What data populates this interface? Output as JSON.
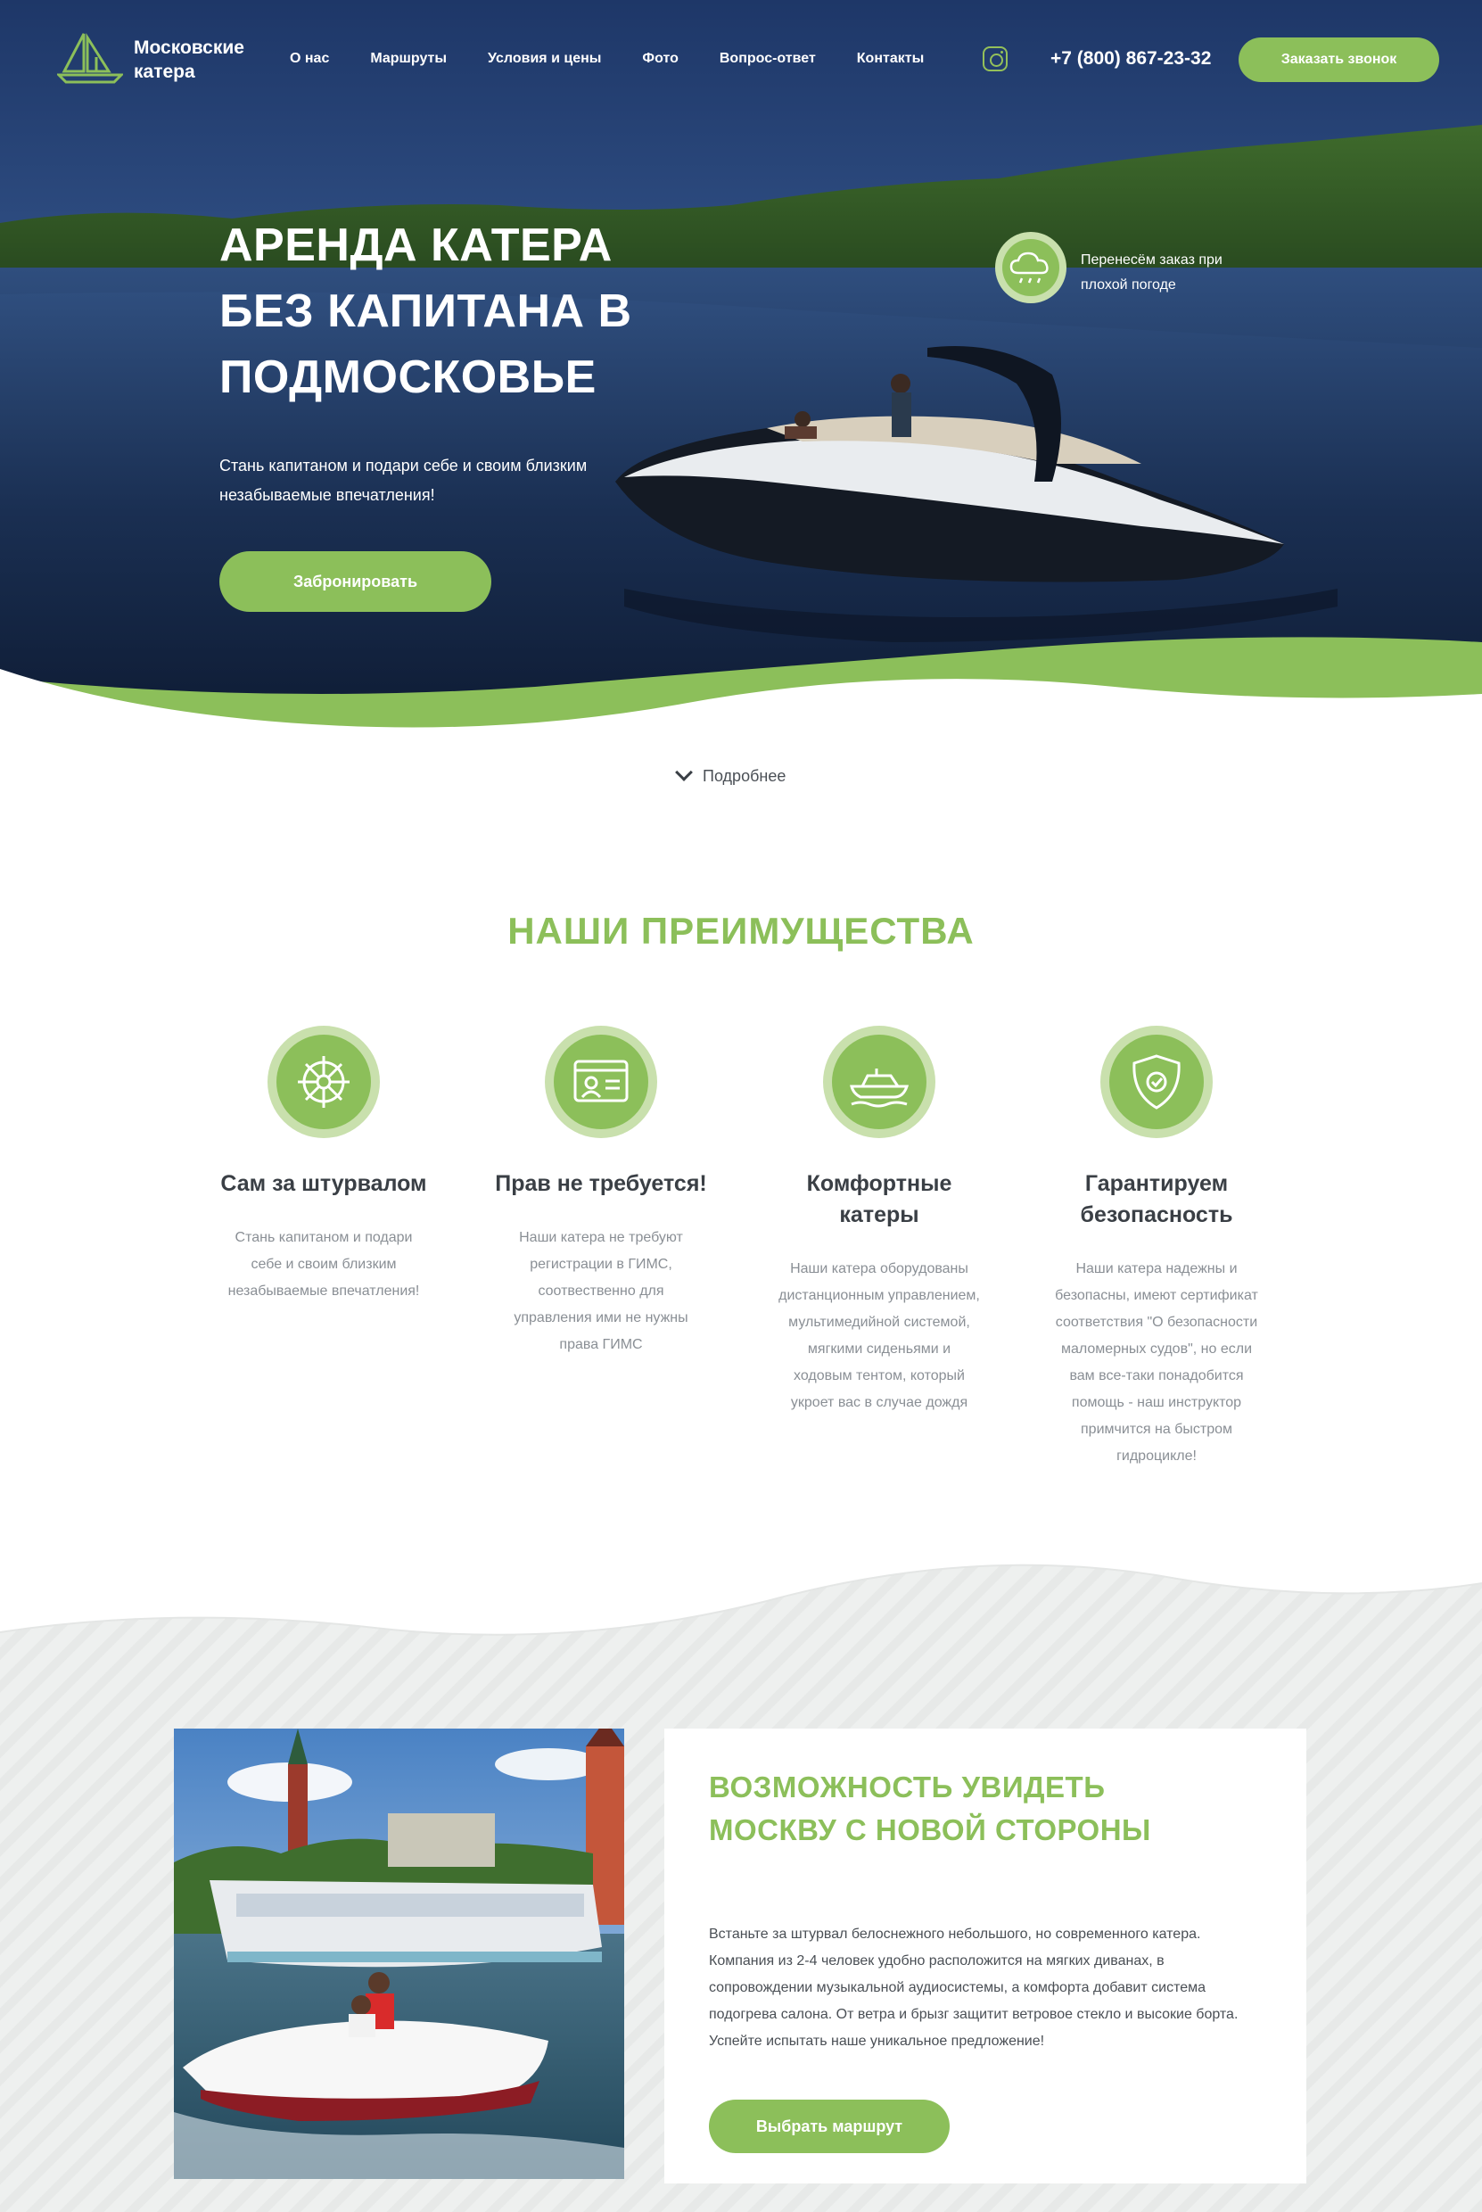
{
  "header": {
    "logo_text": "Московские катера",
    "nav": [
      "О нас",
      "Маршруты",
      "Условия и цены",
      "Фото",
      "Вопрос-ответ",
      "Контакты"
    ],
    "phone": "+7 (800) 867-23-32",
    "call_button": "Заказать звонок"
  },
  "hero": {
    "title": "Аренда катера без капитана в Подмосковье",
    "subtitle": "Стань капитаном и подари себе и своим близким незабываемые впечатления!",
    "book_button": "Забронировать",
    "weather_note": "Перенесём заказ при плохой погоде"
  },
  "more_link": "Подробнее",
  "advantages": {
    "title": "НАШИ ПРЕИМУЩЕСТВА",
    "items": [
      {
        "icon": "helm-icon",
        "title": "Сам за штурвалом",
        "text": "Стань капитаном и подари себе и своим близким незабываемые впечатления!"
      },
      {
        "icon": "license-card-icon",
        "title": "Прав не требуется!",
        "text": "Наши катера не требуют регистрации в ГИМС, соотвественно для управления ими не нужны права ГИМС"
      },
      {
        "icon": "boat-icon",
        "title": "Комфортные катеры",
        "text": "Наши катера оборудованы дистанционным управлением, мультимедийной системой, мягкими сиденьями и ходовым тентом, который укроет вас в случае дождя"
      },
      {
        "icon": "shield-icon",
        "title": "Гарантируем безопасность",
        "text": "Наши катера надежны и безопасны, имеют сертификат соответствия \"О безопасности маломерных судов\", но если вам все-таки понадобится помощь - наш инструктор примчится на быстром гидроцикле!"
      }
    ]
  },
  "feature": {
    "title": "Возможность увидеть Москву с новой стороны",
    "text": "Встаньте за штурвал белоснежного небольшого, но современного катера. Компания из 2-4 человек удобно расположится на мягких диванах, в сопровождении музыкальной аудиосистемы, а комфорта добавит система подогрева салона. От ветра и брызг защитит ветровое стекло и высокие борта. Успейте испытать наше уникальное предложение!",
    "button": "Выбрать маршрут"
  },
  "colors": {
    "accent": "#8cbf5a",
    "accent_light": "#c9e0ad",
    "dark_text": "#3a3f45",
    "muted_text": "#8a8f95"
  }
}
